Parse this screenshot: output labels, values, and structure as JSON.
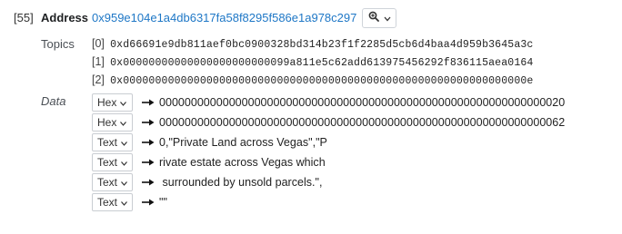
{
  "log": {
    "index": "[55]",
    "address_label": "Address",
    "address": "0x959e104e1a4db6317fa58f8295f586e1a978c297"
  },
  "icons": {
    "search": "magnifier-plus-icon",
    "chevron": "chevron-down-icon",
    "arrow": "right-arrow-icon"
  },
  "topics": {
    "label": "Topics",
    "items": [
      {
        "idx": "[0]",
        "value": "0xd66691e9db811aef0bc0900328bd314b23f1f2285d5cb6d4baa4d959b3645a3c"
      },
      {
        "idx": "[1]",
        "value": "0x00000000000000000000000099a811e5c62add613975456292f836115aea0164"
      },
      {
        "idx": "[2]",
        "value": "0x000000000000000000000000000000000000000000000000000000000000000e"
      }
    ]
  },
  "data": {
    "label": "Data",
    "rows": [
      {
        "format": "Hex",
        "value": "0000000000000000000000000000000000000000000000000000000000000020"
      },
      {
        "format": "Hex",
        "value": "0000000000000000000000000000000000000000000000000000000000000062"
      },
      {
        "format": "Text",
        "value": "0,\"Private Land across Vegas\",\"P"
      },
      {
        "format": "Text",
        "value": "rivate estate across Vegas which"
      },
      {
        "format": "Text",
        "value": " surrounded by unsold parcels.\","
      },
      {
        "format": "Text",
        "value": "\"\""
      }
    ]
  }
}
